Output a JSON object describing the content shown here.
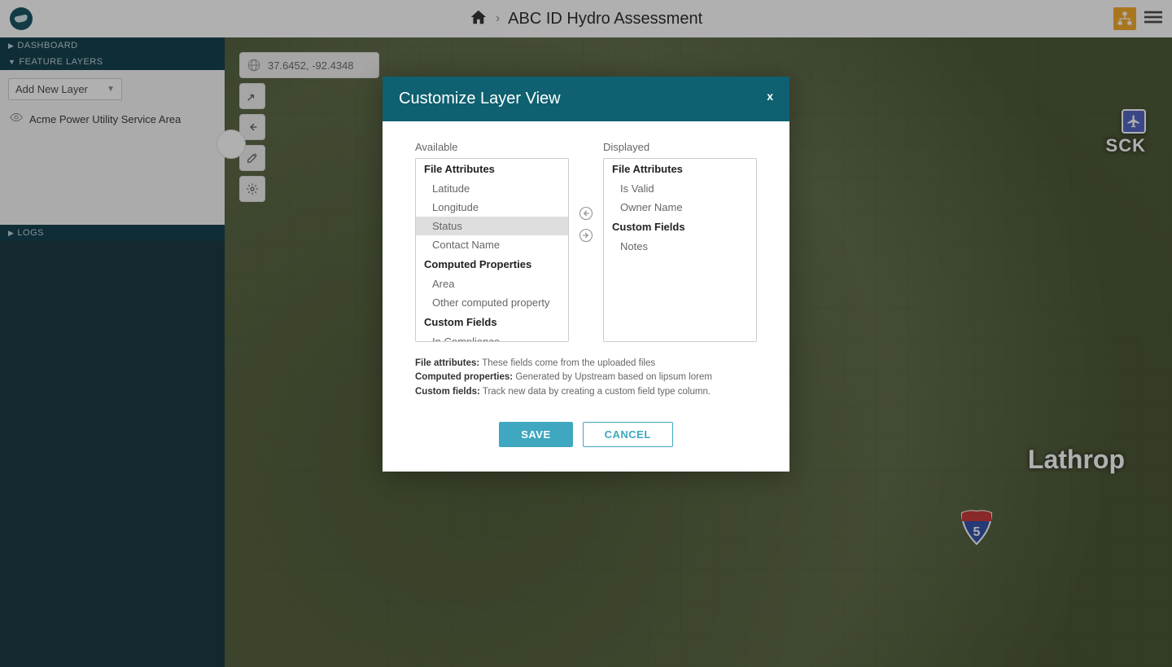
{
  "header": {
    "project_title": "ABC ID Hydro Assessment"
  },
  "sidebar": {
    "nav": {
      "dashboard": "DASHBOARD",
      "feature_layers": "FEATURE LAYERS",
      "logs": "LOGS"
    },
    "add_layer_label": "Add New Layer",
    "layers": [
      {
        "name": "Acme Power Utility Service Area"
      }
    ]
  },
  "map": {
    "coords": "37.6452,  -92.4348",
    "labels": {
      "lathrop": "Lathrop",
      "sck": "SCK",
      "interstate": "5"
    }
  },
  "modal": {
    "title": "Customize Layer View",
    "close_label": "x",
    "available_label": "Available",
    "displayed_label": "Displayed",
    "available": {
      "file_attributes_header": "File Attributes",
      "file_attributes": [
        "Latitude",
        "Longitude",
        "Status",
        "Contact Name"
      ],
      "selected_index": 2,
      "computed_header": "Computed Properties",
      "computed": [
        "Area",
        "Other computed property"
      ],
      "custom_header": "Custom Fields",
      "custom": [
        "In Compliance"
      ]
    },
    "displayed": {
      "file_attributes_header": "File Attributes",
      "file_attributes": [
        "Is Valid",
        "Owner Name"
      ],
      "custom_header": "Custom Fields",
      "custom": [
        "Notes"
      ]
    },
    "legend": {
      "file_attr_label": "File attributes:",
      "file_attr_text": " These fields come from the uploaded files",
      "computed_label": "Computed properties:",
      "computed_text": " Generated by Upstream based on lipsum lorem",
      "custom_label": "Custom fields:",
      "custom_text": " Track new data by creating a custom field type column."
    },
    "buttons": {
      "save": "SAVE",
      "cancel": "CANCEL"
    }
  }
}
